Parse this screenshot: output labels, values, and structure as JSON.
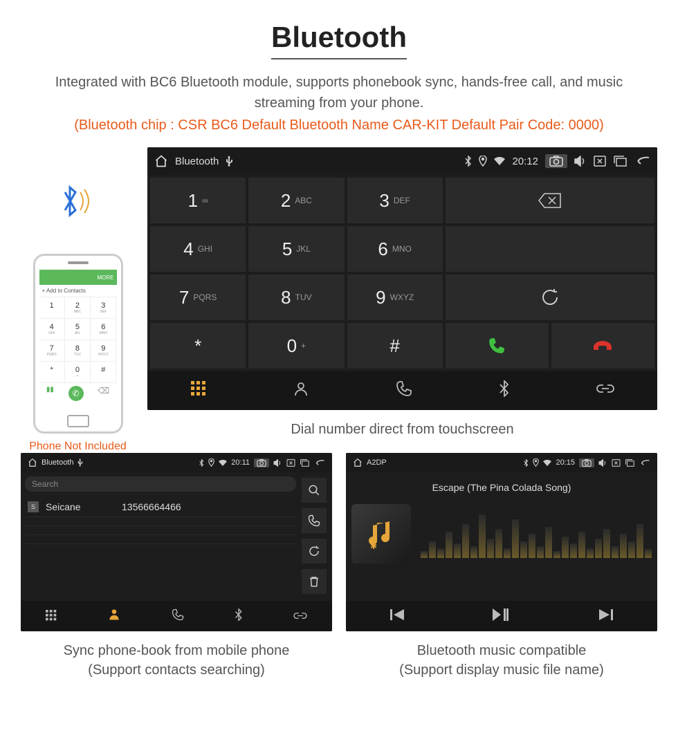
{
  "header": {
    "title": "Bluetooth",
    "subtitle": "Integrated with BC6 Bluetooth module, supports phonebook sync, hands-free call, and music streaming from your phone.",
    "info": "(Bluetooth chip : CSR BC6     Default Bluetooth Name CAR-KIT     Default Pair Code: 0000)"
  },
  "phone": {
    "add_contacts": "+  Add to Contacts",
    "top_label": "MORE",
    "keys": [
      {
        "n": "1",
        "s": ""
      },
      {
        "n": "2",
        "s": "ABC"
      },
      {
        "n": "3",
        "s": "DEF"
      },
      {
        "n": "4",
        "s": "GHI"
      },
      {
        "n": "5",
        "s": "JKL"
      },
      {
        "n": "6",
        "s": "MNO"
      },
      {
        "n": "7",
        "s": "PQRS"
      },
      {
        "n": "8",
        "s": "TUV"
      },
      {
        "n": "9",
        "s": "WXYZ"
      },
      {
        "n": "*",
        "s": ""
      },
      {
        "n": "0",
        "s": "+"
      },
      {
        "n": "#",
        "s": ""
      }
    ],
    "caption": "Phone Not Included"
  },
  "dialer": {
    "status": {
      "title": "Bluetooth",
      "time": "20:12"
    },
    "keys": [
      {
        "n": "1",
        "s": "∞"
      },
      {
        "n": "2",
        "s": "ABC"
      },
      {
        "n": "3",
        "s": "DEF"
      },
      {
        "n": "4",
        "s": "GHI"
      },
      {
        "n": "5",
        "s": "JKL"
      },
      {
        "n": "6",
        "s": "MNO"
      },
      {
        "n": "7",
        "s": "PQRS"
      },
      {
        "n": "8",
        "s": "TUV"
      },
      {
        "n": "9",
        "s": "WXYZ"
      },
      {
        "n": "*",
        "s": ""
      },
      {
        "n": "0",
        "s": "+"
      },
      {
        "n": "#",
        "s": ""
      }
    ],
    "caption": "Dial number direct from touchscreen"
  },
  "contacts": {
    "status": {
      "title": "Bluetooth",
      "time": "20:11"
    },
    "search_placeholder": "Search",
    "list": [
      {
        "badge": "S",
        "name": "Seicane",
        "number": "13566664466"
      }
    ],
    "caption_l1": "Sync phone-book from mobile phone",
    "caption_l2": "(Support contacts searching)"
  },
  "music": {
    "status": {
      "title": "A2DP",
      "time": "20:15"
    },
    "song": "Escape (The Pina Colada Song)",
    "caption_l1": "Bluetooth music compatible",
    "caption_l2": "(Support display music file name)"
  }
}
